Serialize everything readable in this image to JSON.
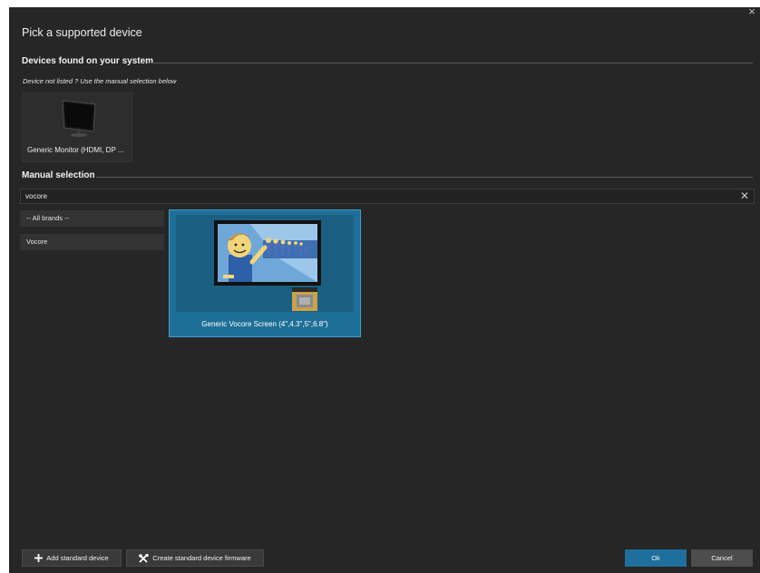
{
  "dialog": {
    "title": "Pick a supported device",
    "close_glyph": "×"
  },
  "found": {
    "header": "Devices found on your system",
    "hint": "Device not listed ? Use the manual selection below",
    "devices": [
      {
        "label": "Generic Monitor (HDMI, DP ...",
        "icon": "monitor-icon"
      }
    ]
  },
  "manual": {
    "header": "Manual selection",
    "search": {
      "value": "vocore",
      "placeholder": "",
      "clear_glyph": "✕"
    },
    "brands": [
      {
        "label": "-- All brands --"
      },
      {
        "label": "Vocore"
      }
    ],
    "devices": [
      {
        "label": "Generic Vocore Screen (4\",4.3\",5\",6.8\")",
        "selected": true
      }
    ]
  },
  "footer": {
    "add_label": "Add standard device",
    "firmware_label": "Create standard device firmware",
    "ok_label": "Ok",
    "cancel_label": "Cancel"
  },
  "colors": {
    "dialog_bg": "#262626",
    "accent": "#1f6f9c",
    "selected_card": "#1e6f97"
  }
}
